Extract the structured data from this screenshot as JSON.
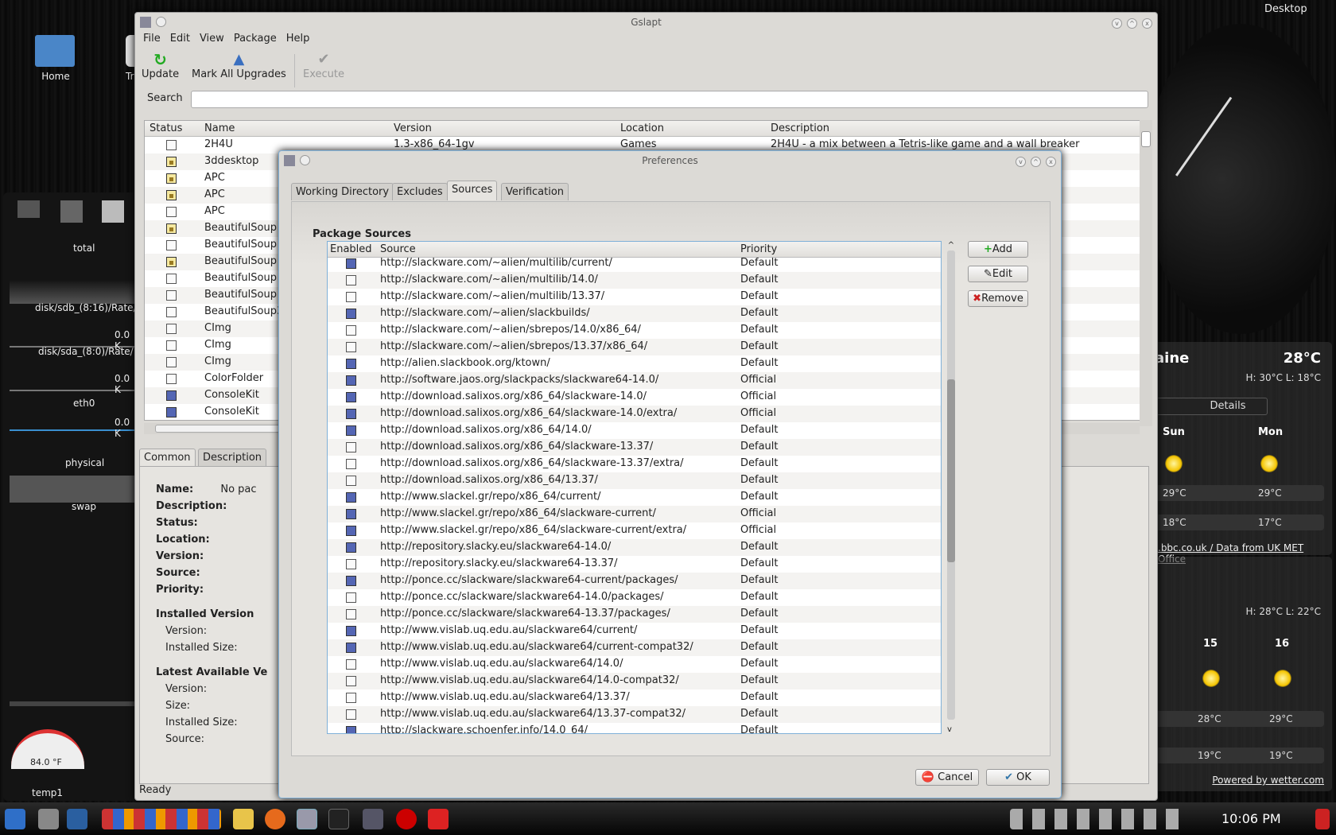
{
  "desktop": {
    "icons": [
      {
        "label": "Home"
      },
      {
        "label": "Tr"
      }
    ],
    "corner_label": "Desktop"
  },
  "sysmon": {
    "labels": [
      "total",
      "disk/sdb_(8:16)/Rate/",
      "disk/sda_(8:0)/Rate/",
      "eth0",
      "physical",
      "swap",
      "temp1"
    ],
    "rate_values": [
      "0.0 K",
      "0.0 K",
      "0.0 K"
    ],
    "gauge": "84.0 °F",
    "cut": [
      "D",
      "Te",
      "te"
    ]
  },
  "gslapt": {
    "title": "Gslapt",
    "menu": [
      "File",
      "Edit",
      "View",
      "Package",
      "Help"
    ],
    "toolbar": {
      "update": "Update",
      "mark_all": "Mark All Upgrades",
      "execute": "Execute"
    },
    "search_label": "Search",
    "search_value": "",
    "columns": [
      "Status",
      "Name",
      "Version",
      "Location",
      "Description"
    ],
    "packages": [
      {
        "status": "none",
        "name": "2H4U",
        "version": "1.3-x86_64-1gv",
        "location": "Games",
        "description": "2H4U - a mix between a Tetris-like game and a wall breaker"
      },
      {
        "status": "lock",
        "name": "3ddesktop"
      },
      {
        "status": "lock",
        "name": "APC"
      },
      {
        "status": "lock",
        "name": "APC"
      },
      {
        "status": "none",
        "name": "APC"
      },
      {
        "status": "lock",
        "name": "BeautifulSoup"
      },
      {
        "status": "none",
        "name": "BeautifulSoup"
      },
      {
        "status": "lock",
        "name": "BeautifulSoup"
      },
      {
        "status": "none",
        "name": "BeautifulSoup"
      },
      {
        "status": "none",
        "name": "BeautifulSoup"
      },
      {
        "status": "none",
        "name": "BeautifulSoup3"
      },
      {
        "status": "none",
        "name": "CImg"
      },
      {
        "status": "none",
        "name": "CImg"
      },
      {
        "status": "none",
        "name": "CImg"
      },
      {
        "status": "none",
        "name": "ColorFolder"
      },
      {
        "status": "installed",
        "name": "ConsoleKit"
      },
      {
        "status": "installed",
        "name": "ConsoleKit"
      }
    ],
    "detail_tabs": [
      "Common",
      "Description"
    ],
    "details": {
      "name_label": "Name:",
      "name_value": "No pac",
      "fields": [
        "Description:",
        "Status:",
        "Location:",
        "Version:",
        "Source:",
        "Priority:"
      ],
      "installed_heading": "Installed Version",
      "installed_fields": [
        "Version:",
        "Installed Size:"
      ],
      "latest_heading": "Latest Available Ve",
      "latest_fields": [
        "Version:",
        "Size:",
        "Installed Size:",
        "Source:"
      ]
    },
    "status": "Ready"
  },
  "prefs": {
    "title": "Preferences",
    "tabs": [
      "Working Directory",
      "Excludes",
      "Sources",
      "Verification"
    ],
    "active_tab": "Sources",
    "heading": "Package Sources",
    "columns": [
      "Enabled",
      "Source",
      "Priority"
    ],
    "buttons": {
      "add": "Add",
      "edit": "Edit",
      "remove": "Remove",
      "cancel": "Cancel",
      "ok": "OK"
    },
    "sources": [
      {
        "on": true,
        "url": "http://slackware.com/~alien/multilib/current/",
        "priority": "Default"
      },
      {
        "on": false,
        "url": "http://slackware.com/~alien/multilib/14.0/",
        "priority": "Default"
      },
      {
        "on": false,
        "url": "http://slackware.com/~alien/multilib/13.37/",
        "priority": "Default"
      },
      {
        "on": true,
        "url": "http://slackware.com/~alien/slackbuilds/",
        "priority": "Default"
      },
      {
        "on": false,
        "url": "http://slackware.com/~alien/sbrepos/14.0/x86_64/",
        "priority": "Default"
      },
      {
        "on": false,
        "url": "http://slackware.com/~alien/sbrepos/13.37/x86_64/",
        "priority": "Default"
      },
      {
        "on": true,
        "url": "http://alien.slackbook.org/ktown/",
        "priority": "Default"
      },
      {
        "on": true,
        "url": "http://software.jaos.org/slackpacks/slackware64-14.0/",
        "priority": "Official"
      },
      {
        "on": true,
        "url": "http://download.salixos.org/x86_64/slackware-14.0/",
        "priority": "Official"
      },
      {
        "on": true,
        "url": "http://download.salixos.org/x86_64/slackware-14.0/extra/",
        "priority": "Official"
      },
      {
        "on": true,
        "url": "http://download.salixos.org/x86_64/14.0/",
        "priority": "Default"
      },
      {
        "on": false,
        "url": "http://download.salixos.org/x86_64/slackware-13.37/",
        "priority": "Default"
      },
      {
        "on": false,
        "url": "http://download.salixos.org/x86_64/slackware-13.37/extra/",
        "priority": "Default"
      },
      {
        "on": false,
        "url": "http://download.salixos.org/x86_64/13.37/",
        "priority": "Default"
      },
      {
        "on": true,
        "url": "http://www.slackel.gr/repo/x86_64/current/",
        "priority": "Default"
      },
      {
        "on": true,
        "url": "http://www.slackel.gr/repo/x86_64/slackware-current/",
        "priority": "Official"
      },
      {
        "on": true,
        "url": "http://www.slackel.gr/repo/x86_64/slackware-current/extra/",
        "priority": "Official"
      },
      {
        "on": true,
        "url": "http://repository.slacky.eu/slackware64-14.0/",
        "priority": "Default"
      },
      {
        "on": false,
        "url": "http://repository.slacky.eu/slackware64-13.37/",
        "priority": "Default"
      },
      {
        "on": true,
        "url": "http://ponce.cc/slackware/slackware64-current/packages/",
        "priority": "Default"
      },
      {
        "on": false,
        "url": "http://ponce.cc/slackware/slackware64-14.0/packages/",
        "priority": "Default"
      },
      {
        "on": false,
        "url": "http://ponce.cc/slackware/slackware64-13.37/packages/",
        "priority": "Default"
      },
      {
        "on": true,
        "url": "http://www.vislab.uq.edu.au/slackware64/current/",
        "priority": "Default"
      },
      {
        "on": true,
        "url": "http://www.vislab.uq.edu.au/slackware64/current-compat32/",
        "priority": "Default"
      },
      {
        "on": false,
        "url": "http://www.vislab.uq.edu.au/slackware64/14.0/",
        "priority": "Default"
      },
      {
        "on": false,
        "url": "http://www.vislab.uq.edu.au/slackware64/14.0-compat32/",
        "priority": "Default"
      },
      {
        "on": false,
        "url": "http://www.vislab.uq.edu.au/slackware64/13.37/",
        "priority": "Default"
      },
      {
        "on": false,
        "url": "http://www.vislab.uq.edu.au/slackware64/13.37-compat32/",
        "priority": "Default"
      },
      {
        "on": true,
        "url": "http://slackware.schoenfer.info/14.0_64/",
        "priority": "Default"
      }
    ],
    "scroll_fraction": 0.45
  },
  "weather1": {
    "city": "aine",
    "temp": "28°C",
    "hilo": "H: 30°C L: 18°C",
    "details": "Details",
    "days": [
      "Sun",
      "Mon"
    ],
    "highs": [
      "29°C",
      "29°C"
    ],
    "lows": [
      "18°C",
      "17°C"
    ],
    "credit": ".bbc.co.uk / Data from UK MET Office"
  },
  "weather2": {
    "hilo": "H: 28°C L: 22°C",
    "days": [
      "15",
      "16"
    ],
    "highs": [
      "28°C",
      "29°C"
    ],
    "lows": [
      "19°C",
      "19°C"
    ],
    "credit": "Powered by wetter.com"
  },
  "taskbar": {
    "clock": "10:06 PM"
  }
}
